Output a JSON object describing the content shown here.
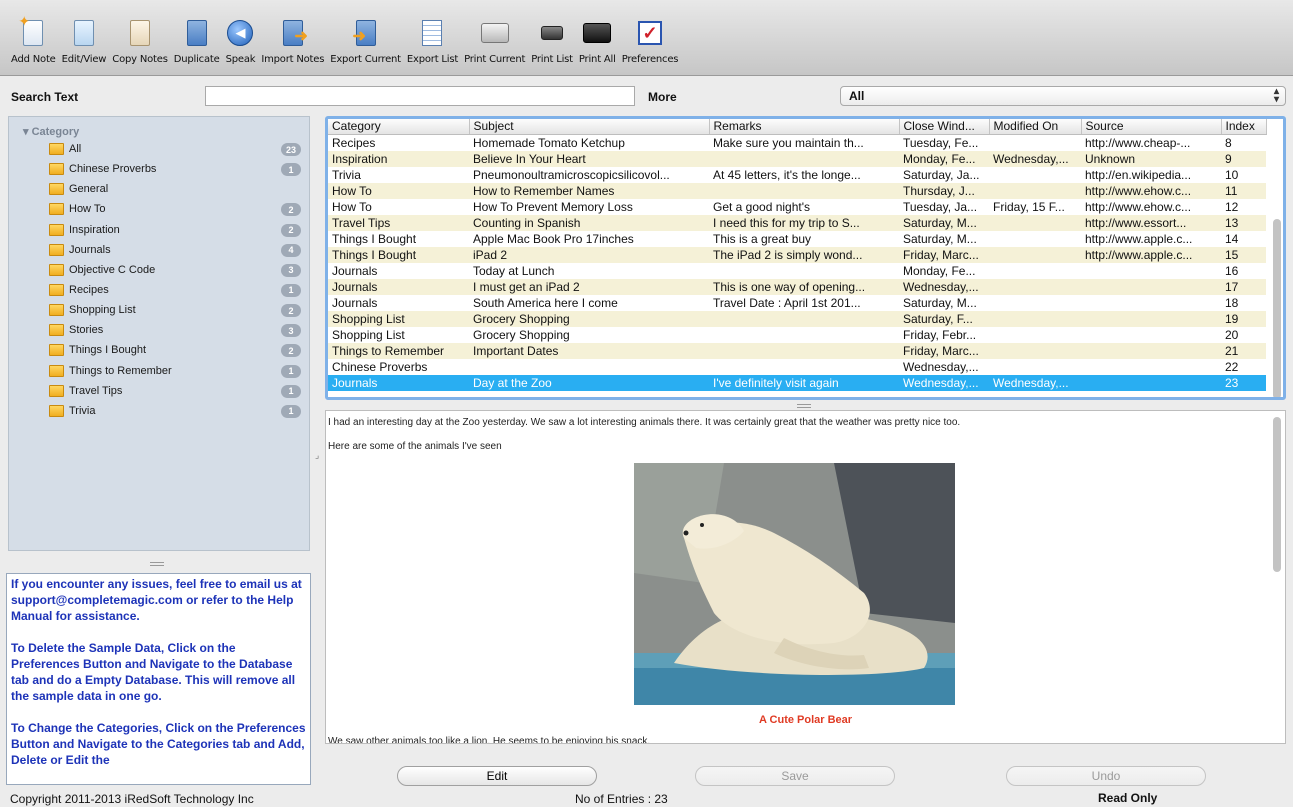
{
  "toolbar": {
    "buttons": [
      {
        "label": "Add Note",
        "icon": "add-note-icon"
      },
      {
        "label": "Edit/View",
        "icon": "edit-view-icon"
      },
      {
        "label": "Copy Notes",
        "icon": "copy-notes-icon"
      },
      {
        "label": "Duplicate",
        "icon": "duplicate-icon"
      },
      {
        "label": "Speak",
        "icon": "speak-icon"
      },
      {
        "label": "Import Notes",
        "icon": "import-notes-icon"
      },
      {
        "label": "Export Current",
        "icon": "export-current-icon"
      },
      {
        "label": "Export List",
        "icon": "export-list-icon"
      },
      {
        "label": "Print Current",
        "icon": "print-current-icon"
      },
      {
        "label": "Print List",
        "icon": "print-list-icon"
      },
      {
        "label": "Print All",
        "icon": "print-all-icon"
      },
      {
        "label": "Preferences",
        "icon": "preferences-icon"
      }
    ]
  },
  "search": {
    "label": "Search Text",
    "value": "",
    "more_label": "More",
    "filter_value": "All"
  },
  "sidebar": {
    "header": "Category",
    "categories": [
      {
        "name": "All",
        "count": "23"
      },
      {
        "name": "Chinese Proverbs",
        "count": "1"
      },
      {
        "name": "General",
        "count": ""
      },
      {
        "name": "How To",
        "count": "2"
      },
      {
        "name": "Inspiration",
        "count": "2"
      },
      {
        "name": "Journals",
        "count": "4"
      },
      {
        "name": "Objective C Code",
        "count": "3"
      },
      {
        "name": "Recipes",
        "count": "1"
      },
      {
        "name": "Shopping List",
        "count": "2"
      },
      {
        "name": "Stories",
        "count": "3"
      },
      {
        "name": "Things I Bought",
        "count": "2"
      },
      {
        "name": "Things to Remember",
        "count": "1"
      },
      {
        "name": "Travel Tips",
        "count": "1"
      },
      {
        "name": "Trivia",
        "count": "1"
      }
    ]
  },
  "info": {
    "paragraphs": [
      "If you encounter any issues, feel free to email us at support@completemagic.com or refer to the Help Manual for assistance.",
      "To Delete the Sample Data, Click on the Preferences Button and Navigate to the Database tab and do a Empty Database. This will remove all the sample data in one go.",
      "To Change the Categories, Click on the Preferences Button and Navigate to the Categories tab and Add, Delete or Edit the"
    ]
  },
  "table": {
    "columns": [
      "Category",
      "Subject",
      "Remarks",
      "Close Wind...",
      "Modified On",
      "Source",
      "Index"
    ],
    "rows": [
      [
        "Recipes",
        "Homemade Tomato Ketchup",
        "Make sure you maintain th...",
        "Tuesday, Fe...",
        "",
        "http://www.cheap-...",
        "8"
      ],
      [
        "Inspiration",
        "Believe In Your Heart",
        "",
        "Monday, Fe...",
        "Wednesday,...",
        "Unknown",
        "9"
      ],
      [
        "Trivia",
        "Pneumonoultramicroscopicsilicovol...",
        "At 45 letters, it's the longe...",
        "Saturday, Ja...",
        "",
        "http://en.wikipedia...",
        "10"
      ],
      [
        "How To",
        "How to Remember Names",
        "",
        "Thursday, J...",
        "",
        "http://www.ehow.c...",
        "11"
      ],
      [
        "How To",
        "How To Prevent Memory Loss",
        "Get a good night's",
        "Tuesday, Ja...",
        "Friday, 15 F...",
        "http://www.ehow.c...",
        "12"
      ],
      [
        "Travel Tips",
        "Counting in Spanish",
        "I need this for my trip to S...",
        "Saturday, M...",
        "",
        "http://www.essort...",
        "13"
      ],
      [
        "Things I Bought",
        "Apple Mac Book Pro 17inches",
        "This is a great buy",
        "Saturday, M...",
        "",
        "http://www.apple.c...",
        "14"
      ],
      [
        "Things I Bought",
        "iPad 2",
        "The iPad 2 is simply wond...",
        "Friday, Marc...",
        "",
        "http://www.apple.c...",
        "15"
      ],
      [
        "Journals",
        "Today at Lunch",
        "",
        "Monday, Fe...",
        "",
        "",
        "16"
      ],
      [
        "Journals",
        "I must get an iPad 2",
        "This is one way of opening...",
        "Wednesday,...",
        "",
        "",
        "17"
      ],
      [
        "Journals",
        "South America here I come",
        "Travel Date : April 1st 201...",
        "Saturday, M...",
        "",
        "",
        "18"
      ],
      [
        "Shopping List",
        "Grocery Shopping",
        "",
        "Saturday, F...",
        "",
        "",
        "19"
      ],
      [
        "Shopping List",
        "Grocery Shopping",
        "",
        "Friday, Febr...",
        "",
        "",
        "20"
      ],
      [
        "Things to Remember",
        "Important Dates",
        "",
        "Friday, Marc...",
        "",
        "",
        "21"
      ],
      [
        "Chinese Proverbs",
        "",
        "",
        "Wednesday,...",
        "",
        "",
        "22"
      ],
      [
        "Journals",
        "Day at the Zoo",
        "I've definitely visit again",
        "Wednesday,...",
        "Wednesday,...",
        "",
        "23"
      ]
    ],
    "selected_index": 15
  },
  "note": {
    "line1": "I had an interesting day at the Zoo yesterday. We saw a lot interesting animals there. It was certainly great that the weather was pretty nice too.",
    "line2": "Here are some of the animals I've seen",
    "caption": "A Cute Polar Bear",
    "line3": "We saw other animals too like a lion. He seems to be enjoying his snack."
  },
  "buttons": {
    "edit": "Edit",
    "save": "Save",
    "undo": "Undo"
  },
  "status": {
    "copyright": "Copyright 2011-2013 iRedSoft Technology Inc",
    "entries": "No of Entries : 23",
    "mode": "Read Only"
  },
  "colors": {
    "selection": "#29aef2",
    "alt_row": "#f5f1d7",
    "info_text": "#1d33b8",
    "caption": "#e03b24"
  }
}
